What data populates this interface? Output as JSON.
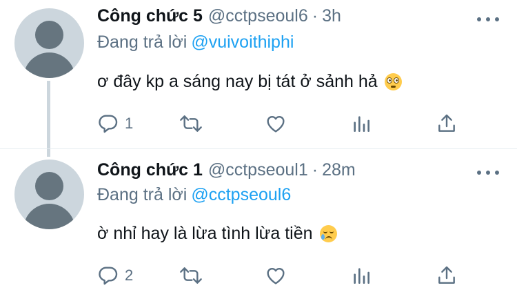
{
  "tweets": [
    {
      "name": "Công chức 5",
      "handle": "@cctpseoul6",
      "separator": "·",
      "time": "3h",
      "reply_prefix": "Đang trả lời",
      "reply_to": "@vuivoithiphi",
      "text": "ơ đây kp a sáng nay bị tát ở sảnh hả",
      "emoji": "flushed-face-emoji",
      "reply_count": "1",
      "has_thread_line": true
    },
    {
      "name": "Công chức 1",
      "handle": "@cctpseoul1",
      "separator": "·",
      "time": "28m",
      "reply_prefix": "Đang trả lời",
      "reply_to": "@cctpseoul6",
      "text": "ờ nhỉ hay là lừa tình lừa tiền",
      "emoji": "smiling-face-with-tear-emoji",
      "reply_count": "2",
      "has_thread_line": false
    }
  ],
  "icons": {
    "reply": "reply-icon",
    "retweet": "retweet-icon",
    "like": "heart-icon",
    "analytics": "analytics-icon",
    "share": "share-icon",
    "more": "more-options-icon"
  },
  "colors": {
    "text": "#0f1419",
    "secondary": "#5b7083",
    "link": "#1da1f2",
    "avatar_bg": "#ccd6dd",
    "avatar_fg": "#66757f"
  }
}
